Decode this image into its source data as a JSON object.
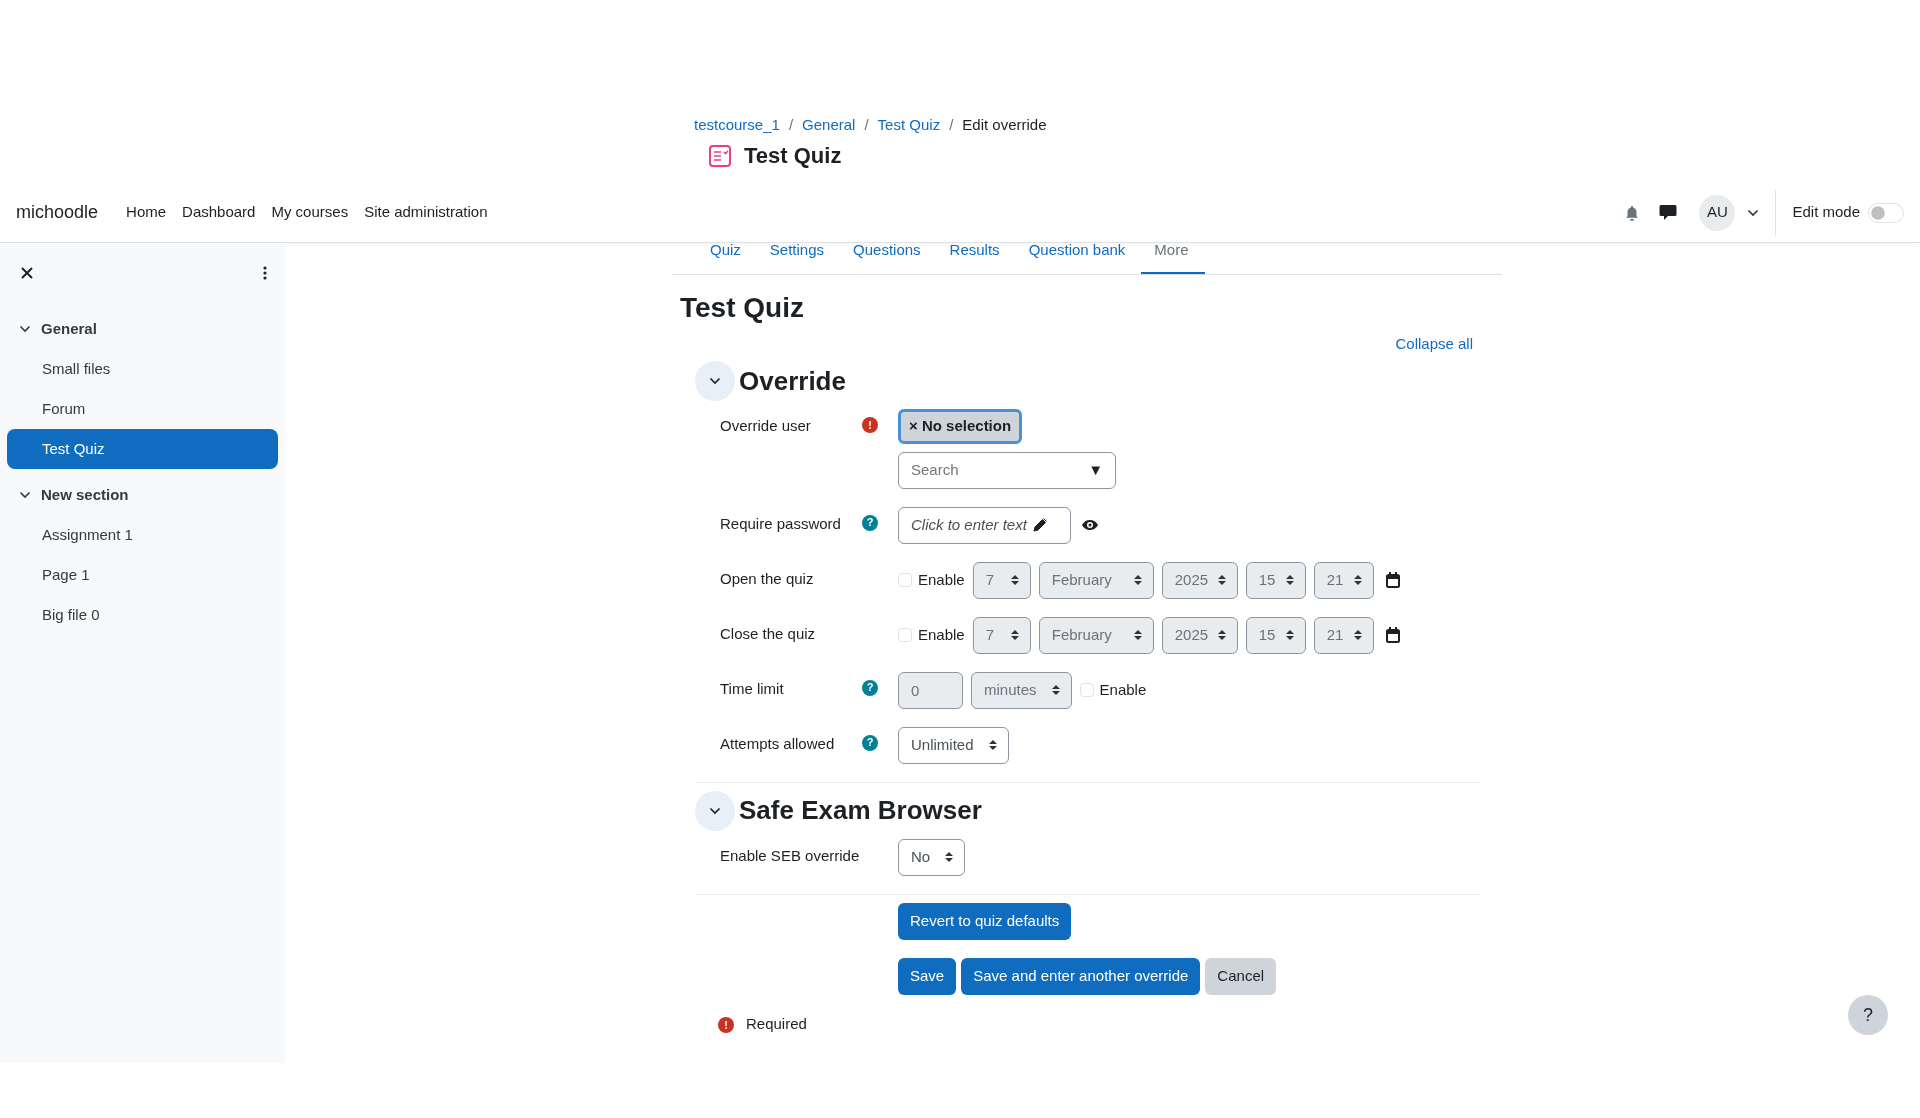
{
  "breadcrumb": [
    {
      "label": "testcourse_1",
      "link": true
    },
    {
      "label": "General",
      "link": true
    },
    {
      "label": "Test Quiz",
      "link": true
    },
    {
      "label": "Edit override",
      "link": false
    }
  ],
  "separator": "/",
  "page_heading": "Test Quiz",
  "navbar": {
    "brand": "michoodle",
    "links": [
      "Home",
      "Dashboard",
      "My courses",
      "Site administration"
    ],
    "avatar": "AU",
    "edit_mode": {
      "label": "Edit mode",
      "on": false
    }
  },
  "sidebar": {
    "sections": [
      {
        "title": "General",
        "expanded": true,
        "children": [
          {
            "label": "Small files",
            "selected": false
          },
          {
            "label": "Forum",
            "selected": false
          },
          {
            "label": "Test Quiz",
            "selected": true
          }
        ]
      },
      {
        "title": "New section",
        "expanded": true,
        "children": [
          {
            "label": "Assignment 1",
            "selected": false
          },
          {
            "label": "Page 1",
            "selected": false
          },
          {
            "label": "Big file 0",
            "selected": false
          }
        ]
      }
    ]
  },
  "tabs": [
    {
      "label": "Quiz",
      "selected": false
    },
    {
      "label": "Settings",
      "selected": false
    },
    {
      "label": "Questions",
      "selected": false
    },
    {
      "label": "Results",
      "selected": false
    },
    {
      "label": "Question bank",
      "selected": false
    },
    {
      "label": "More",
      "selected": true
    }
  ],
  "title": "Test Quiz",
  "collapse_all": "Collapse all",
  "sections": [
    {
      "title": "Override",
      "expanded": true,
      "fields": [
        {
          "kind": "autocomplete",
          "label": "Override user",
          "marker": {
            "kind": "required",
            "glyph": "!"
          },
          "chip": {
            "remove": "×",
            "label": "No selection"
          },
          "placeholder": "Search",
          "toggle": "▼"
        },
        {
          "kind": "password",
          "label": "Require password",
          "marker": {
            "kind": "help",
            "glyph": "?"
          },
          "value": "Click to enter text"
        },
        {
          "kind": "datetime",
          "label": "Open the quiz",
          "enable": {
            "label": "Enable",
            "checked": false
          },
          "disabled": true,
          "parts": [
            "7",
            "February",
            "2025",
            "15",
            "21"
          ]
        },
        {
          "kind": "datetime",
          "label": "Close the quiz",
          "enable": {
            "label": "Enable",
            "checked": false
          },
          "disabled": true,
          "parts": [
            "7",
            "February",
            "2025",
            "15",
            "21"
          ]
        },
        {
          "kind": "duration",
          "label": "Time limit",
          "marker": {
            "kind": "help",
            "glyph": "?"
          },
          "value": "0",
          "unit": "minutes",
          "enable": {
            "label": "Enable",
            "checked": false
          },
          "disabled": true
        },
        {
          "kind": "select",
          "label": "Attempts allowed",
          "marker": {
            "kind": "help",
            "glyph": "?"
          },
          "value": "Unlimited"
        }
      ]
    },
    {
      "title": "Safe Exam Browser",
      "expanded": true,
      "fields": [
        {
          "kind": "select",
          "label": "Enable SEB override",
          "value": "No"
        }
      ]
    }
  ],
  "button_rows": [
    [
      {
        "label": "Revert to quiz defaults",
        "kind": "primary"
      }
    ],
    [
      {
        "label": "Save",
        "kind": "primary"
      },
      {
        "label": "Save and enter another override",
        "kind": "primary"
      },
      {
        "label": "Cancel",
        "kind": "secondary"
      }
    ]
  ],
  "required_note": {
    "glyph": "!",
    "text": "Required"
  },
  "help_button": "?"
}
